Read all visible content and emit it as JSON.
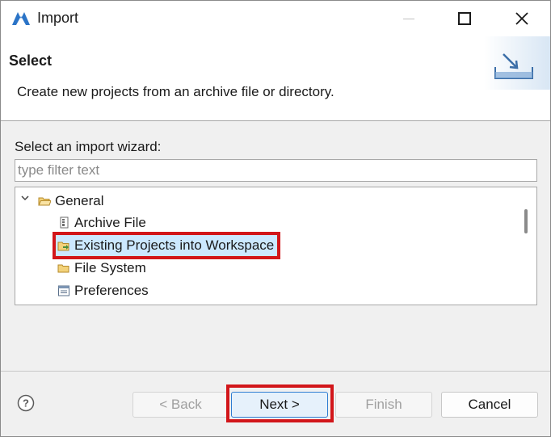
{
  "window": {
    "title": "Import",
    "logo_icon": "eclipse-logo-icon",
    "controls": [
      "minimize-icon",
      "maximize-icon",
      "close-icon"
    ]
  },
  "header": {
    "title": "Select",
    "description": "Create new projects from an archive file or directory.",
    "graphic_icon": "import-wizard-graphic"
  },
  "filter": {
    "label": "Select an import wizard:",
    "placeholder": "type filter text",
    "value": ""
  },
  "tree": {
    "items": [
      {
        "label": "General",
        "icon": "folder-open-icon",
        "expanded": true,
        "level": 0
      },
      {
        "label": "Archive File",
        "icon": "archive-file-icon",
        "level": 1
      },
      {
        "label": "Existing Projects into Workspace",
        "icon": "existing-projects-icon",
        "level": 1,
        "selected": true
      },
      {
        "label": "File System",
        "icon": "folder-icon",
        "level": 1
      },
      {
        "label": "Preferences",
        "icon": "preferences-icon",
        "level": 1
      }
    ]
  },
  "footer": {
    "help_icon": "help-icon",
    "back_label": "< Back",
    "next_label": "Next >",
    "finish_label": "Finish",
    "cancel_label": "Cancel"
  },
  "colors": {
    "highlight_box": "#d2161a",
    "selection_bg": "#cce8ff",
    "default_button_border": "#2e7dd2"
  }
}
